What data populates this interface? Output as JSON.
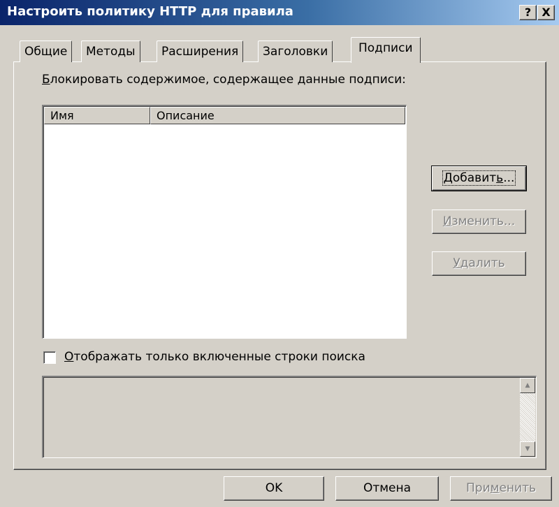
{
  "window": {
    "title": "Настроить политику HTTP для правила",
    "help_glyph": "?",
    "close_glyph": "X"
  },
  "tabs": [
    {
      "label": "Общие",
      "active": false
    },
    {
      "label": "Методы",
      "active": false
    },
    {
      "label": "Расширения",
      "active": false
    },
    {
      "label": "Заголовки",
      "active": false
    },
    {
      "label": "Подписи",
      "active": true
    }
  ],
  "signatures": {
    "group_label_mnemonic": "Б",
    "group_label_rest": "локировать содержимое, содержащее данные подписи:",
    "columns": [
      "Имя",
      "Описание"
    ],
    "rows": []
  },
  "buttons": {
    "add": {
      "pre": "Добавит",
      "mnemonic": "ь",
      "post": "...",
      "enabled": true
    },
    "edit": {
      "mnemonic": "И",
      "post": "зменить...",
      "enabled": false
    },
    "delete": {
      "mnemonic": "У",
      "post": "далить",
      "enabled": false
    }
  },
  "filter_checkbox": {
    "checked": false,
    "mnemonic": "О",
    "rest": "тображать только включенные строки поиска"
  },
  "details_text": "",
  "footer": {
    "ok": "OK",
    "cancel": "Отмена",
    "apply_pre": "При",
    "apply_mnemonic": "м",
    "apply_post": "енить"
  }
}
